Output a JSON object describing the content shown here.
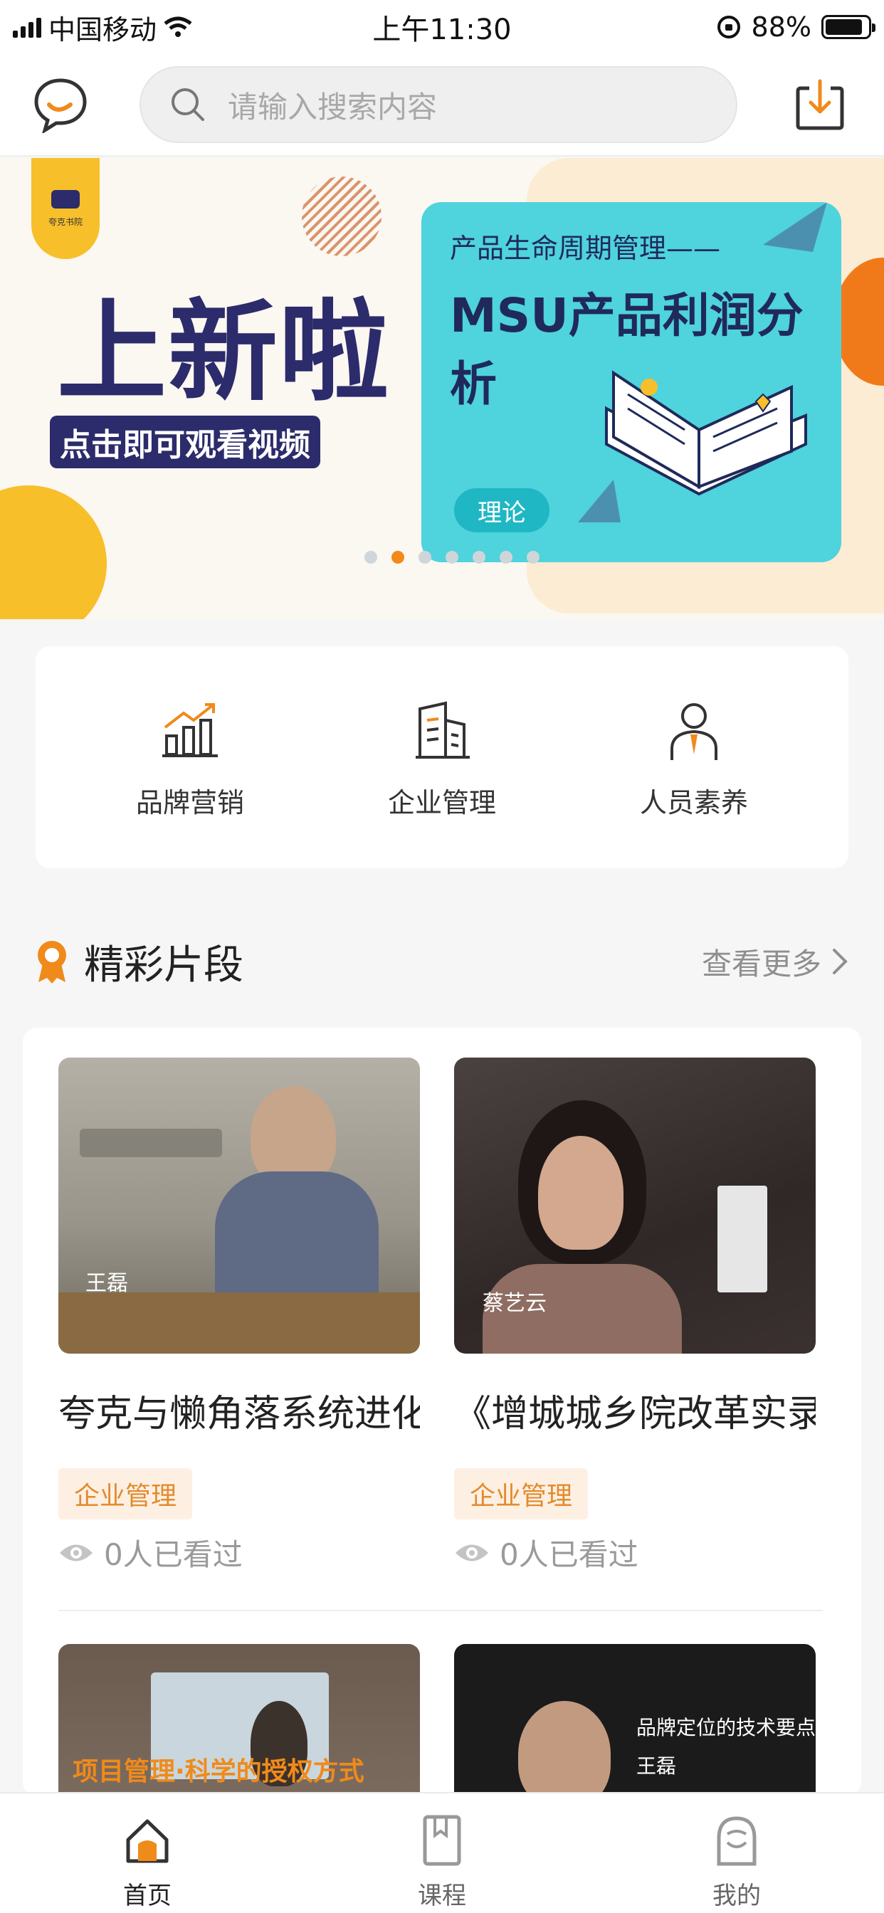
{
  "status_bar": {
    "carrier": "中国移动",
    "time": "上午11:30",
    "battery_percent": "88%",
    "battery_level": 0.88
  },
  "header": {
    "search_placeholder": "请输入搜索内容",
    "icons": [
      "chat-bubble-icon",
      "search-icon",
      "download-icon"
    ]
  },
  "banner": {
    "badge_text": "夸克书院",
    "headline": "上新啦",
    "subline": "点击即可观看视频",
    "card_subtitle": "产品生命周期管理——",
    "card_title": "MSU产品利润分析",
    "card_tag": "理论",
    "dots_count": 7,
    "active_dot": 1,
    "colors": {
      "navy": "#2c2b6b",
      "yellow": "#f7bf2a",
      "teal": "#4fd3dd",
      "orange": "#f08a1a"
    }
  },
  "categories": [
    {
      "label": "品牌营销",
      "icon": "chart-growth-icon"
    },
    {
      "label": "企业管理",
      "icon": "building-icon"
    },
    {
      "label": "人员素养",
      "icon": "person-tie-icon"
    }
  ],
  "section": {
    "title": "精彩片段",
    "more_label": "查看更多",
    "icon": "medal-icon"
  },
  "videos": [
    {
      "title": "夸克与懒角落系统进化实践",
      "tag": "企业管理",
      "views": "0人已看过",
      "caption": "王磊"
    },
    {
      "title": "《增城城乡院改革实录》",
      "tag": "企业管理",
      "views": "0人已看过",
      "caption": "蔡艺云"
    },
    {
      "title": "",
      "caption": "项目管理·科学的授权方式"
    },
    {
      "title": "",
      "caption": "品牌定位的技术要点",
      "caption2": "王磊"
    }
  ],
  "tab_bar": [
    {
      "label": "首页",
      "icon": "home-icon",
      "active": true
    },
    {
      "label": "课程",
      "icon": "book-icon",
      "active": false
    },
    {
      "label": "我的",
      "icon": "profile-icon",
      "active": false
    }
  ],
  "accent_color": "#f08a1a"
}
